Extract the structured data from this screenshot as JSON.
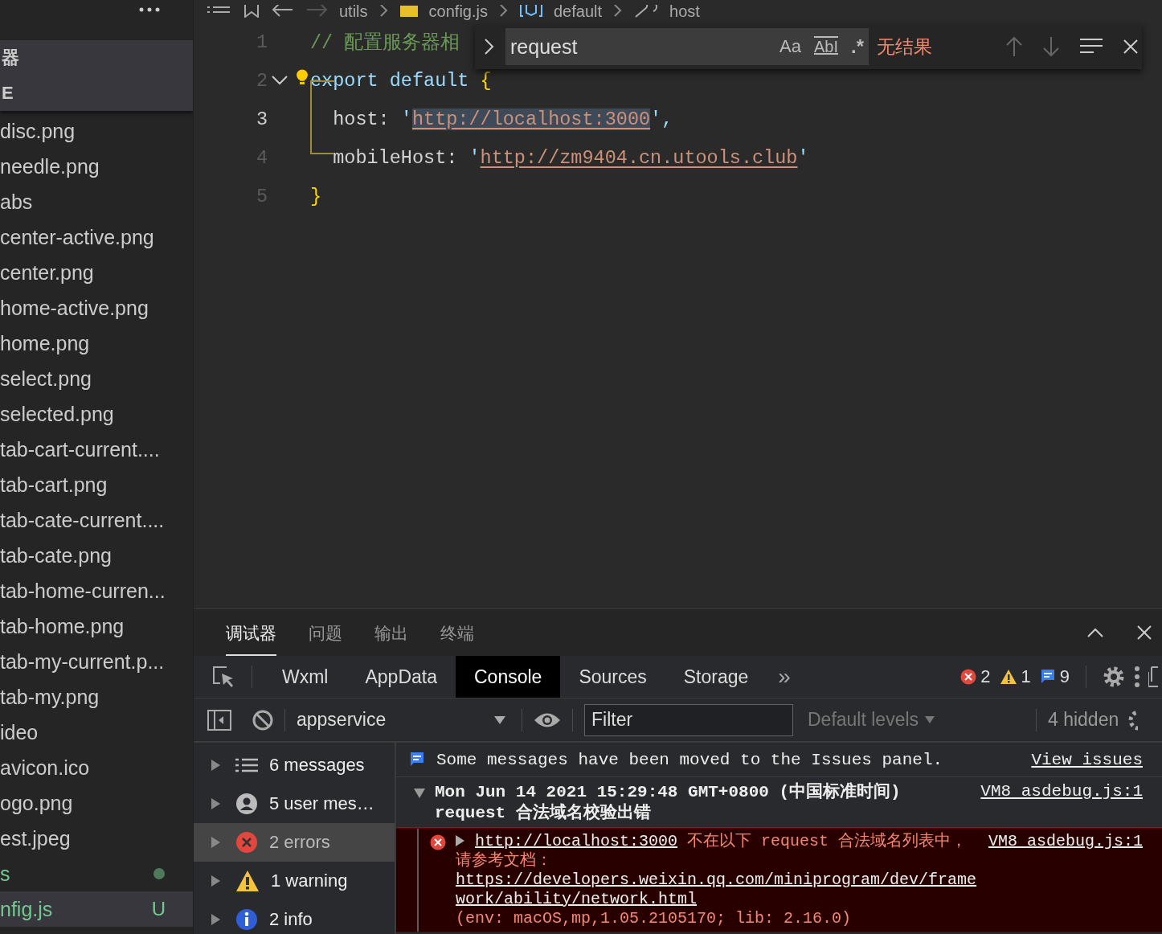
{
  "sidebar": {
    "sections": [
      {
        "label": "器"
      },
      {
        "label": "E"
      }
    ],
    "files": [
      {
        "name": "disc.png",
        "kind": "plain",
        "selected": false
      },
      {
        "name": "needle.png",
        "kind": "plain",
        "selected": false
      },
      {
        "name": "abs",
        "kind": "plain",
        "selected": false
      },
      {
        "name": "center-active.png",
        "kind": "plain",
        "selected": false
      },
      {
        "name": "center.png",
        "kind": "plain",
        "selected": false
      },
      {
        "name": "home-active.png",
        "kind": "plain",
        "selected": false
      },
      {
        "name": "home.png",
        "kind": "plain",
        "selected": false
      },
      {
        "name": "select.png",
        "kind": "plain",
        "selected": false
      },
      {
        "name": "selected.png",
        "kind": "plain",
        "selected": false
      },
      {
        "name": "tab-cart-current....",
        "kind": "plain",
        "selected": false
      },
      {
        "name": "tab-cart.png",
        "kind": "plain",
        "selected": false
      },
      {
        "name": "tab-cate-current....",
        "kind": "plain",
        "selected": false
      },
      {
        "name": "tab-cate.png",
        "kind": "plain",
        "selected": false
      },
      {
        "name": "tab-home-curren...",
        "kind": "plain",
        "selected": false
      },
      {
        "name": "tab-home.png",
        "kind": "plain",
        "selected": false
      },
      {
        "name": "tab-my-current.p...",
        "kind": "plain",
        "selected": false
      },
      {
        "name": "tab-my.png",
        "kind": "plain",
        "selected": false
      },
      {
        "name": "ideo",
        "kind": "plain",
        "selected": false
      },
      {
        "name": "avicon.ico",
        "kind": "plain",
        "selected": false
      },
      {
        "name": "ogo.png",
        "kind": "plain",
        "selected": false
      },
      {
        "name": "est.jpeg",
        "kind": "plain",
        "selected": false
      },
      {
        "name": "s",
        "kind": "changed",
        "selected": false
      },
      {
        "name": "nfig.js",
        "kind": "untracked",
        "status": "U",
        "selected": true
      }
    ]
  },
  "editor": {
    "breadcrumb": [
      "utils",
      "config.js",
      "default",
      "host"
    ],
    "lines": [
      {
        "number": "1",
        "current": false,
        "tokens": [
          {
            "kind": "comment",
            "text": "// 配置服务器相"
          }
        ]
      },
      {
        "number": "2",
        "current": false,
        "tokens": [
          {
            "kind": "keyword",
            "text": "export default "
          },
          {
            "kind": "bracket",
            "text": "{"
          }
        ]
      },
      {
        "number": "3",
        "current": true,
        "tokens": [
          {
            "kind": "plain",
            "text": "  host: "
          },
          {
            "kind": "quote",
            "text": "'"
          },
          {
            "kind": "string",
            "text": "http://localhost:3000",
            "highlighted": true
          },
          {
            "kind": "quote",
            "text": "',"
          }
        ]
      },
      {
        "number": "4",
        "current": false,
        "tokens": [
          {
            "kind": "plain",
            "text": "  mobileHost: "
          },
          {
            "kind": "quote",
            "text": "'"
          },
          {
            "kind": "string",
            "text": "http://zm9404.cn.utools.club",
            "highlighted": false
          },
          {
            "kind": "quote",
            "text": "'"
          }
        ]
      },
      {
        "number": "5",
        "current": false,
        "tokens": [
          {
            "kind": "bracket",
            "text": "}"
          }
        ]
      }
    ],
    "find": {
      "value": "request",
      "options": [
        {
          "label": "Aa",
          "on": false
        },
        {
          "label": "AbI",
          "on": false
        },
        {
          "label": ".*",
          "on": false
        }
      ],
      "result": "无结果"
    }
  },
  "panel": {
    "tabs": [
      {
        "label": "调试器",
        "selected": true
      },
      {
        "label": "问题",
        "selected": false
      },
      {
        "label": "输出",
        "selected": false
      },
      {
        "label": "终端",
        "selected": false
      }
    ],
    "devtools_tabs": [
      {
        "label": "Wxml",
        "selected": false
      },
      {
        "label": "AppData",
        "selected": false
      },
      {
        "label": "Console",
        "selected": true
      },
      {
        "label": "Sources",
        "selected": false
      },
      {
        "label": "Storage",
        "selected": false
      }
    ],
    "more": "»",
    "counts": {
      "errors": "2",
      "warnings": "1",
      "info": "9"
    },
    "context": "appservice",
    "filter": {
      "placeholder": "Filter"
    },
    "levels": "Default levels",
    "hidden": "4 hidden",
    "groups": [
      {
        "kind": "all",
        "label": "6 messages",
        "selected": false
      },
      {
        "kind": "user",
        "label": "5 user mes…",
        "selected": false
      },
      {
        "kind": "error",
        "label": "2 errors",
        "selected": true
      },
      {
        "kind": "warning",
        "label": "1 warning",
        "selected": false
      },
      {
        "kind": "info",
        "label": "2 info",
        "selected": false
      }
    ],
    "banner": {
      "text": "Some messages have been moved to the Issues panel.",
      "link": "View issues"
    },
    "group_message": {
      "title": "Mon Jun 14 2021 15:29:48 GMT+0800 (中国标准时间)",
      "source": "VM8 asdebug.js:1",
      "subtitle": "request 合法域名校验出错",
      "expanded": true
    },
    "error": {
      "link": "http://localhost:3000",
      "text": " 不在以下 request 合法域名列表中，请参考文档：",
      "doc_link": "https://developers.weixin.qq.com/miniprogram/dev/framework/ability/network.html",
      "env": "(env: macOS,mp,1.05.2105170; lib: 2.16.0)",
      "source": "VM8 asdebug.js:1"
    }
  }
}
